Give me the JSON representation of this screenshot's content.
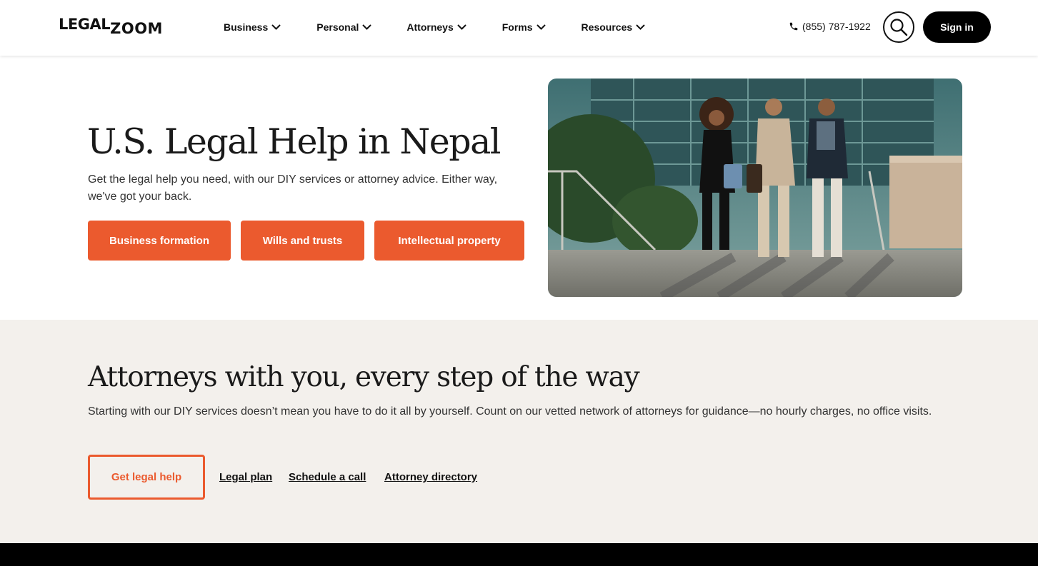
{
  "header": {
    "logo_top": "LEGAL",
    "logo_bottom": "ZOOM",
    "nav": [
      {
        "label": "Business"
      },
      {
        "label": "Personal"
      },
      {
        "label": "Attorneys"
      },
      {
        "label": "Forms"
      },
      {
        "label": "Resources"
      }
    ],
    "phone": "(855) 787-1922",
    "signin_label": "Sign in"
  },
  "hero": {
    "title": "U.S. Legal Help in Nepal",
    "subtitle": "Get the legal help you need, with our DIY services or attorney advice. Either way, we've got your back.",
    "buttons": [
      {
        "label": "Business formation"
      },
      {
        "label": "Wills and trusts"
      },
      {
        "label": "Intellectual property"
      }
    ]
  },
  "attorneys": {
    "title": "Attorneys with you, every step of the way",
    "subtitle": "Starting with our DIY services doesn’t mean you have to do it all by yourself. Count on our vetted network of attorneys for guidance—no hourly charges, no office visits.",
    "primary_label": "Get legal help",
    "links": [
      {
        "label": "Legal plan"
      },
      {
        "label": "Schedule a call"
      },
      {
        "label": "Attorney directory"
      }
    ]
  },
  "colors": {
    "accent": "#eb5a2e",
    "section_bg": "#f3f0ec",
    "dark": "#000000"
  },
  "icons": [
    "chevron-down-icon",
    "phone-icon",
    "search-icon"
  ]
}
